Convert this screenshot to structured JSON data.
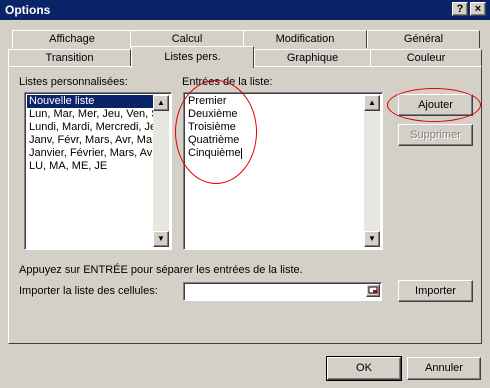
{
  "window": {
    "title": "Options",
    "help_glyph": "?",
    "close_glyph": "×"
  },
  "tabs": {
    "row_back": [
      "Affichage",
      "Calcul",
      "Modification",
      "Général"
    ],
    "row_front": [
      "Transition",
      "Listes pers.",
      "Graphique",
      "Couleur"
    ],
    "active": "Listes pers."
  },
  "lists": {
    "label": "Listes personnalisées:",
    "items": [
      "Nouvelle liste",
      "Lun, Mar, Mer, Jeu, Ven, S",
      "Lundi, Mardi, Mercredi, Jeu",
      "Janv, Févr, Mars, Avr, Ma",
      "Janvier, Février, Mars, Av",
      "LU, MA, ME, JE"
    ],
    "selected_index": 0
  },
  "entries": {
    "label": "Entrées de la liste:",
    "items": [
      "Premier",
      "Deuxième",
      "Troisième",
      "Quatrième",
      "Cinquième"
    ]
  },
  "buttons": {
    "add": "Ajouter",
    "delete": "Supprimer",
    "import": "Importer",
    "ok": "OK",
    "cancel": "Annuler"
  },
  "hint": "Appuyez sur ENTRÉE pour séparer les entrées de la liste.",
  "import_label": "Importer la liste des cellules:",
  "import_value": "",
  "annotation_color": "#e00000"
}
